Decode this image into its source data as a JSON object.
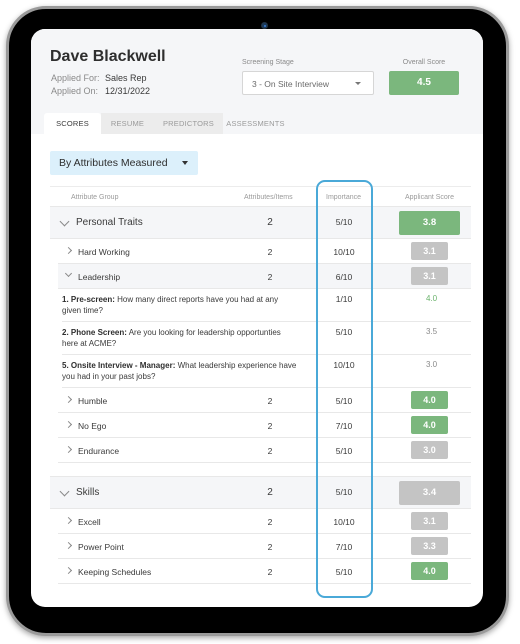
{
  "candidate": {
    "name": "Dave Blackwell",
    "applied_for_label": "Applied For:",
    "applied_for": "Sales Rep",
    "applied_on_label": "Applied On:",
    "applied_on": "12/31/2022"
  },
  "screening_stage": {
    "label": "Screening Stage",
    "value": "3 - On Site Interview"
  },
  "overall_score": {
    "label": "Overall Score",
    "value": "4.5",
    "color": "#7bb77d"
  },
  "tabs": [
    {
      "label": "SCORES",
      "active": true
    },
    {
      "label": "RESUME",
      "active": false
    },
    {
      "label": "PREDICTORS",
      "active": false
    },
    {
      "label": "ASSESSMENTS",
      "active": false
    }
  ],
  "view_selector": {
    "value": "By Attributes Measured"
  },
  "table": {
    "columns": [
      "Attribute Group",
      "Attributes/Items",
      "Importance",
      "Applicant Score"
    ],
    "rows": {
      "personal_traits": {
        "label": "Personal Traits",
        "items": "2",
        "importance": "5/10",
        "score": "3.8",
        "status": "green"
      },
      "hard_working": {
        "label": "Hard Working",
        "items": "2",
        "importance": "10/10",
        "score": "3.1",
        "status": "gray"
      },
      "leadership": {
        "label": "Leadership",
        "items": "2",
        "importance": "6/10",
        "score": "3.1",
        "status": "gray"
      },
      "q1": {
        "prefix": "1. Pre-screen:",
        "text": " How many direct reports have you had at any given time?",
        "importance": "1/10",
        "score": "4.0"
      },
      "q2": {
        "prefix": "2. Phone Screen:",
        "text": " Are you looking for leadership opportunties here at ACME?",
        "importance": "5/10",
        "score": "3.5"
      },
      "q5": {
        "prefix": "5. Onsite Interview - Manager:",
        "text": " What leadership experience have you had in your past jobs?",
        "importance": "10/10",
        "score": "3.0"
      },
      "humble": {
        "label": "Humble",
        "items": "2",
        "importance": "5/10",
        "score": "4.0",
        "status": "green"
      },
      "no_ego": {
        "label": "No Ego",
        "items": "2",
        "importance": "7/10",
        "score": "4.0",
        "status": "green"
      },
      "endurance": {
        "label": "Endurance",
        "items": "2",
        "importance": "5/10",
        "score": "3.0",
        "status": "gray"
      },
      "skills": {
        "label": "Skills",
        "items": "2",
        "importance": "5/10",
        "score": "3.4",
        "status": "gray"
      },
      "excell": {
        "label": "Excell",
        "items": "2",
        "importance": "10/10",
        "score": "3.1",
        "status": "gray"
      },
      "power_point": {
        "label": "Power Point",
        "items": "2",
        "importance": "7/10",
        "score": "3.3",
        "status": "gray"
      },
      "keeping_schedules": {
        "label": "Keeping Schedules",
        "items": "2",
        "importance": "5/10",
        "score": "4.0",
        "status": "green"
      }
    }
  },
  "colors": {
    "score_green": "#7bb77d",
    "score_gray": "#c4c4c4",
    "highlight": "#4aa9d8",
    "view_selector_bg": "#dcf0fb"
  }
}
